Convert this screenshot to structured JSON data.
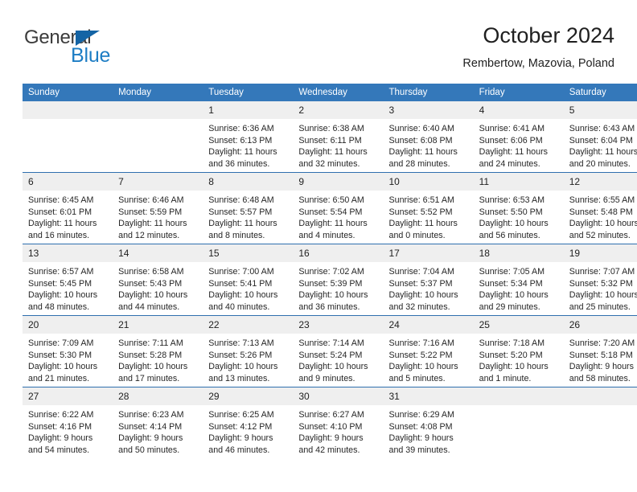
{
  "brand": {
    "name_top": "General",
    "name_bottom": "Blue",
    "triangle_icon": "triangle-icon",
    "color_dark": "#3b3b3b",
    "color_blue": "#1d7dc4",
    "color_triangle": "#1464a5"
  },
  "header": {
    "title": "October 2024",
    "subtitle": "Rembertow, Mazovia, Poland"
  },
  "theme": {
    "header_blue": "#3478ba",
    "row_rule_blue": "#2f6fae",
    "daynum_band": "#efefef"
  },
  "weekday_headers": [
    "Sunday",
    "Monday",
    "Tuesday",
    "Wednesday",
    "Thursday",
    "Friday",
    "Saturday"
  ],
  "weeks": [
    [
      {
        "day": "",
        "empty": true,
        "sunrise": "",
        "sunset": "",
        "daylight_1": "",
        "daylight_2": ""
      },
      {
        "day": "",
        "empty": true,
        "sunrise": "",
        "sunset": "",
        "daylight_1": "",
        "daylight_2": ""
      },
      {
        "day": "1",
        "empty": false,
        "sunrise": "Sunrise: 6:36 AM",
        "sunset": "Sunset: 6:13 PM",
        "daylight_1": "Daylight: 11 hours",
        "daylight_2": "and 36 minutes."
      },
      {
        "day": "2",
        "empty": false,
        "sunrise": "Sunrise: 6:38 AM",
        "sunset": "Sunset: 6:11 PM",
        "daylight_1": "Daylight: 11 hours",
        "daylight_2": "and 32 minutes."
      },
      {
        "day": "3",
        "empty": false,
        "sunrise": "Sunrise: 6:40 AM",
        "sunset": "Sunset: 6:08 PM",
        "daylight_1": "Daylight: 11 hours",
        "daylight_2": "and 28 minutes."
      },
      {
        "day": "4",
        "empty": false,
        "sunrise": "Sunrise: 6:41 AM",
        "sunset": "Sunset: 6:06 PM",
        "daylight_1": "Daylight: 11 hours",
        "daylight_2": "and 24 minutes."
      },
      {
        "day": "5",
        "empty": false,
        "sunrise": "Sunrise: 6:43 AM",
        "sunset": "Sunset: 6:04 PM",
        "daylight_1": "Daylight: 11 hours",
        "daylight_2": "and 20 minutes."
      }
    ],
    [
      {
        "day": "6",
        "empty": false,
        "sunrise": "Sunrise: 6:45 AM",
        "sunset": "Sunset: 6:01 PM",
        "daylight_1": "Daylight: 11 hours",
        "daylight_2": "and 16 minutes."
      },
      {
        "day": "7",
        "empty": false,
        "sunrise": "Sunrise: 6:46 AM",
        "sunset": "Sunset: 5:59 PM",
        "daylight_1": "Daylight: 11 hours",
        "daylight_2": "and 12 minutes."
      },
      {
        "day": "8",
        "empty": false,
        "sunrise": "Sunrise: 6:48 AM",
        "sunset": "Sunset: 5:57 PM",
        "daylight_1": "Daylight: 11 hours",
        "daylight_2": "and 8 minutes."
      },
      {
        "day": "9",
        "empty": false,
        "sunrise": "Sunrise: 6:50 AM",
        "sunset": "Sunset: 5:54 PM",
        "daylight_1": "Daylight: 11 hours",
        "daylight_2": "and 4 minutes."
      },
      {
        "day": "10",
        "empty": false,
        "sunrise": "Sunrise: 6:51 AM",
        "sunset": "Sunset: 5:52 PM",
        "daylight_1": "Daylight: 11 hours",
        "daylight_2": "and 0 minutes."
      },
      {
        "day": "11",
        "empty": false,
        "sunrise": "Sunrise: 6:53 AM",
        "sunset": "Sunset: 5:50 PM",
        "daylight_1": "Daylight: 10 hours",
        "daylight_2": "and 56 minutes."
      },
      {
        "day": "12",
        "empty": false,
        "sunrise": "Sunrise: 6:55 AM",
        "sunset": "Sunset: 5:48 PM",
        "daylight_1": "Daylight: 10 hours",
        "daylight_2": "and 52 minutes."
      }
    ],
    [
      {
        "day": "13",
        "empty": false,
        "sunrise": "Sunrise: 6:57 AM",
        "sunset": "Sunset: 5:45 PM",
        "daylight_1": "Daylight: 10 hours",
        "daylight_2": "and 48 minutes."
      },
      {
        "day": "14",
        "empty": false,
        "sunrise": "Sunrise: 6:58 AM",
        "sunset": "Sunset: 5:43 PM",
        "daylight_1": "Daylight: 10 hours",
        "daylight_2": "and 44 minutes."
      },
      {
        "day": "15",
        "empty": false,
        "sunrise": "Sunrise: 7:00 AM",
        "sunset": "Sunset: 5:41 PM",
        "daylight_1": "Daylight: 10 hours",
        "daylight_2": "and 40 minutes."
      },
      {
        "day": "16",
        "empty": false,
        "sunrise": "Sunrise: 7:02 AM",
        "sunset": "Sunset: 5:39 PM",
        "daylight_1": "Daylight: 10 hours",
        "daylight_2": "and 36 minutes."
      },
      {
        "day": "17",
        "empty": false,
        "sunrise": "Sunrise: 7:04 AM",
        "sunset": "Sunset: 5:37 PM",
        "daylight_1": "Daylight: 10 hours",
        "daylight_2": "and 32 minutes."
      },
      {
        "day": "18",
        "empty": false,
        "sunrise": "Sunrise: 7:05 AM",
        "sunset": "Sunset: 5:34 PM",
        "daylight_1": "Daylight: 10 hours",
        "daylight_2": "and 29 minutes."
      },
      {
        "day": "19",
        "empty": false,
        "sunrise": "Sunrise: 7:07 AM",
        "sunset": "Sunset: 5:32 PM",
        "daylight_1": "Daylight: 10 hours",
        "daylight_2": "and 25 minutes."
      }
    ],
    [
      {
        "day": "20",
        "empty": false,
        "sunrise": "Sunrise: 7:09 AM",
        "sunset": "Sunset: 5:30 PM",
        "daylight_1": "Daylight: 10 hours",
        "daylight_2": "and 21 minutes."
      },
      {
        "day": "21",
        "empty": false,
        "sunrise": "Sunrise: 7:11 AM",
        "sunset": "Sunset: 5:28 PM",
        "daylight_1": "Daylight: 10 hours",
        "daylight_2": "and 17 minutes."
      },
      {
        "day": "22",
        "empty": false,
        "sunrise": "Sunrise: 7:13 AM",
        "sunset": "Sunset: 5:26 PM",
        "daylight_1": "Daylight: 10 hours",
        "daylight_2": "and 13 minutes."
      },
      {
        "day": "23",
        "empty": false,
        "sunrise": "Sunrise: 7:14 AM",
        "sunset": "Sunset: 5:24 PM",
        "daylight_1": "Daylight: 10 hours",
        "daylight_2": "and 9 minutes."
      },
      {
        "day": "24",
        "empty": false,
        "sunrise": "Sunrise: 7:16 AM",
        "sunset": "Sunset: 5:22 PM",
        "daylight_1": "Daylight: 10 hours",
        "daylight_2": "and 5 minutes."
      },
      {
        "day": "25",
        "empty": false,
        "sunrise": "Sunrise: 7:18 AM",
        "sunset": "Sunset: 5:20 PM",
        "daylight_1": "Daylight: 10 hours",
        "daylight_2": "and 1 minute."
      },
      {
        "day": "26",
        "empty": false,
        "sunrise": "Sunrise: 7:20 AM",
        "sunset": "Sunset: 5:18 PM",
        "daylight_1": "Daylight: 9 hours",
        "daylight_2": "and 58 minutes."
      }
    ],
    [
      {
        "day": "27",
        "empty": false,
        "sunrise": "Sunrise: 6:22 AM",
        "sunset": "Sunset: 4:16 PM",
        "daylight_1": "Daylight: 9 hours",
        "daylight_2": "and 54 minutes."
      },
      {
        "day": "28",
        "empty": false,
        "sunrise": "Sunrise: 6:23 AM",
        "sunset": "Sunset: 4:14 PM",
        "daylight_1": "Daylight: 9 hours",
        "daylight_2": "and 50 minutes."
      },
      {
        "day": "29",
        "empty": false,
        "sunrise": "Sunrise: 6:25 AM",
        "sunset": "Sunset: 4:12 PM",
        "daylight_1": "Daylight: 9 hours",
        "daylight_2": "and 46 minutes."
      },
      {
        "day": "30",
        "empty": false,
        "sunrise": "Sunrise: 6:27 AM",
        "sunset": "Sunset: 4:10 PM",
        "daylight_1": "Daylight: 9 hours",
        "daylight_2": "and 42 minutes."
      },
      {
        "day": "31",
        "empty": false,
        "sunrise": "Sunrise: 6:29 AM",
        "sunset": "Sunset: 4:08 PM",
        "daylight_1": "Daylight: 9 hours",
        "daylight_2": "and 39 minutes."
      },
      {
        "day": "",
        "empty": true,
        "sunrise": "",
        "sunset": "",
        "daylight_1": "",
        "daylight_2": ""
      },
      {
        "day": "",
        "empty": true,
        "sunrise": "",
        "sunset": "",
        "daylight_1": "",
        "daylight_2": ""
      }
    ]
  ]
}
